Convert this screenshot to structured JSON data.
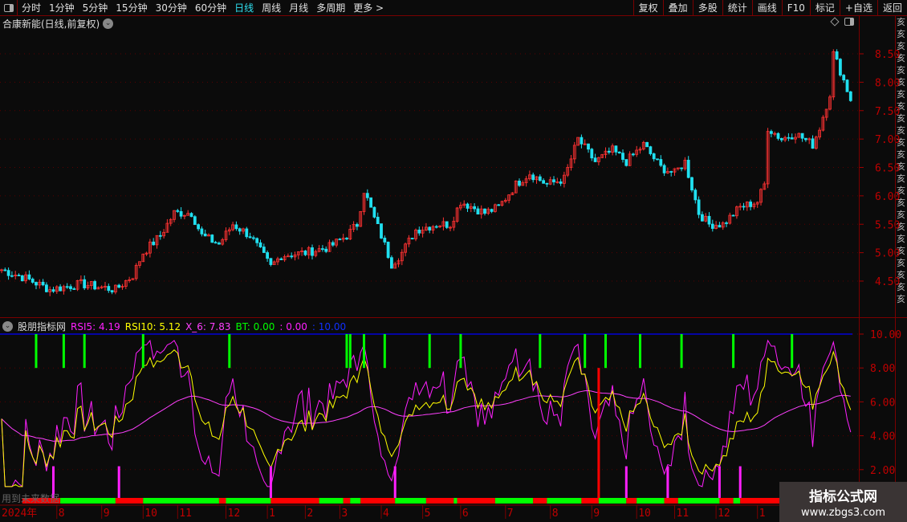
{
  "toolbar": {
    "periods": [
      "分时",
      "1分钟",
      "5分钟",
      "15分钟",
      "30分钟",
      "60分钟",
      "日线",
      "周线",
      "月线",
      "多周期",
      "更多 >"
    ],
    "active_period": "日线",
    "tools": [
      "复权",
      "叠加",
      "多股",
      "统计",
      "画线",
      "F10",
      "标记",
      "+自选",
      "返回"
    ]
  },
  "main": {
    "title": "合康新能(日线,前复权)",
    "price_axis": [
      "8.50",
      "8.00",
      "7.50",
      "7.00",
      "6.50",
      "6.00",
      "5.50",
      "5.00",
      "4.50"
    ]
  },
  "indicator": {
    "name": "股朋指标网",
    "rsi5_label": "RSI5: 4.19",
    "rsi10_label": "RSI10: 5.12",
    "x6_label": "X_6: 7.83",
    "bt_label": "BT: 0.00",
    "v2_label": ": 0.00",
    "v3_label": ": 10.00",
    "axis": [
      "10.00",
      "8.00",
      "6.00",
      "4.00",
      "2.00"
    ],
    "future_note": "用到未来数据"
  },
  "colors": {
    "up": "#ff3232",
    "down": "#20e0f0",
    "rsi5": "#ff20ff",
    "rsi10": "#ffff00",
    "x6": "#ff40ff",
    "bt": "#00ff00",
    "line10": "#0000ff",
    "axis": "#c00000"
  },
  "dates": {
    "year_label": "2024年",
    "months": [
      [
        "8",
        16
      ],
      [
        "9",
        29
      ],
      [
        "10",
        41
      ],
      [
        "11",
        51
      ],
      [
        "12",
        65
      ],
      [
        "1",
        77
      ],
      [
        "2",
        88
      ],
      [
        "3",
        98
      ],
      [
        "4",
        110
      ],
      [
        "5",
        122
      ],
      [
        "6",
        133
      ],
      [
        "7",
        146
      ],
      [
        "8",
        159
      ],
      [
        "9",
        171
      ],
      [
        "10",
        184
      ],
      [
        "11",
        195
      ],
      [
        "12",
        207
      ],
      [
        "1",
        219
      ]
    ]
  },
  "chart_data": {
    "type": "candlestick",
    "price_keypoints": [
      [
        0,
        4.7
      ],
      [
        7,
        4.55
      ],
      [
        14,
        4.35
      ],
      [
        23,
        4.45
      ],
      [
        33,
        4.35
      ],
      [
        38,
        4.6
      ],
      [
        41,
        5.0
      ],
      [
        46,
        5.3
      ],
      [
        50,
        5.7
      ],
      [
        55,
        5.7
      ],
      [
        58,
        5.3
      ],
      [
        63,
        5.15
      ],
      [
        67,
        5.5
      ],
      [
        72,
        5.3
      ],
      [
        78,
        4.75
      ],
      [
        81,
        4.95
      ],
      [
        88,
        5.0
      ],
      [
        95,
        5.1
      ],
      [
        100,
        5.3
      ],
      [
        103,
        5.5
      ],
      [
        105,
        6.1
      ],
      [
        108,
        5.6
      ],
      [
        110,
        5.3
      ],
      [
        113,
        4.8
      ],
      [
        116,
        5.0
      ],
      [
        120,
        5.4
      ],
      [
        126,
        5.5
      ],
      [
        130,
        5.5
      ],
      [
        133,
        5.9
      ],
      [
        140,
        5.7
      ],
      [
        144,
        5.8
      ],
      [
        149,
        6.2
      ],
      [
        153,
        6.4
      ],
      [
        158,
        6.2
      ],
      [
        163,
        6.3
      ],
      [
        167,
        7.0
      ],
      [
        172,
        6.6
      ],
      [
        177,
        6.8
      ],
      [
        181,
        6.6
      ],
      [
        186,
        6.9
      ],
      [
        191,
        6.5
      ],
      [
        195,
        6.4
      ],
      [
        198,
        6.6
      ],
      [
        202,
        5.7
      ],
      [
        205,
        5.5
      ],
      [
        209,
        5.5
      ],
      [
        214,
        5.8
      ],
      [
        219,
        5.9
      ],
      [
        221,
        6.2
      ],
      [
        222,
        7.2
      ],
      [
        226,
        7.0
      ],
      [
        230,
        7.1
      ],
      [
        235,
        6.9
      ],
      [
        237,
        7.2
      ],
      [
        240,
        7.8
      ],
      [
        241,
        8.5
      ],
      [
        243,
        8.2
      ],
      [
        246,
        7.7
      ]
    ],
    "ylim": [
      4.2,
      8.9
    ],
    "indicator_ylim": [
      1,
      10.5
    ],
    "bt_top_signals": [
      10,
      18,
      24,
      41,
      66,
      100,
      101,
      105,
      111,
      124,
      133,
      156,
      169,
      175,
      185,
      197,
      212,
      229
    ],
    "bottom_signals": [
      15,
      34,
      78,
      114,
      181,
      193,
      208,
      214
    ],
    "red_signal": 173,
    "state_segments": [
      [
        "r",
        6,
        17
      ],
      [
        "g",
        17,
        33
      ],
      [
        "r",
        33,
        41
      ],
      [
        "g",
        41,
        63
      ],
      [
        "r",
        63,
        65
      ],
      [
        "g",
        65,
        78
      ],
      [
        "r",
        78,
        92
      ],
      [
        "g",
        92,
        99
      ],
      [
        "r",
        99,
        101
      ],
      [
        "g",
        101,
        104
      ],
      [
        "r",
        104,
        114
      ],
      [
        "g",
        114,
        123
      ],
      [
        "r",
        123,
        131
      ],
      [
        "g",
        131,
        132
      ],
      [
        "r",
        132,
        143
      ],
      [
        "g",
        143,
        154
      ],
      [
        "r",
        154,
        158
      ],
      [
        "g",
        158,
        168
      ],
      [
        "r",
        168,
        173
      ],
      [
        "g",
        173,
        181
      ],
      [
        "r",
        181,
        184
      ],
      [
        "g",
        184,
        192
      ],
      [
        "r",
        192,
        196
      ],
      [
        "g",
        196,
        208
      ],
      [
        "r",
        208,
        212
      ],
      [
        "g",
        212,
        214
      ],
      [
        "r",
        214,
        226
      ]
    ]
  },
  "watermark": {
    "line1": "指标公式网",
    "line2": "www.zbgs3.com"
  },
  "side_strip": "亥亥亥亥亥亥亥亥亥亥亥亥亥亥亥亥亥亥亥亥亥亥亥亥"
}
